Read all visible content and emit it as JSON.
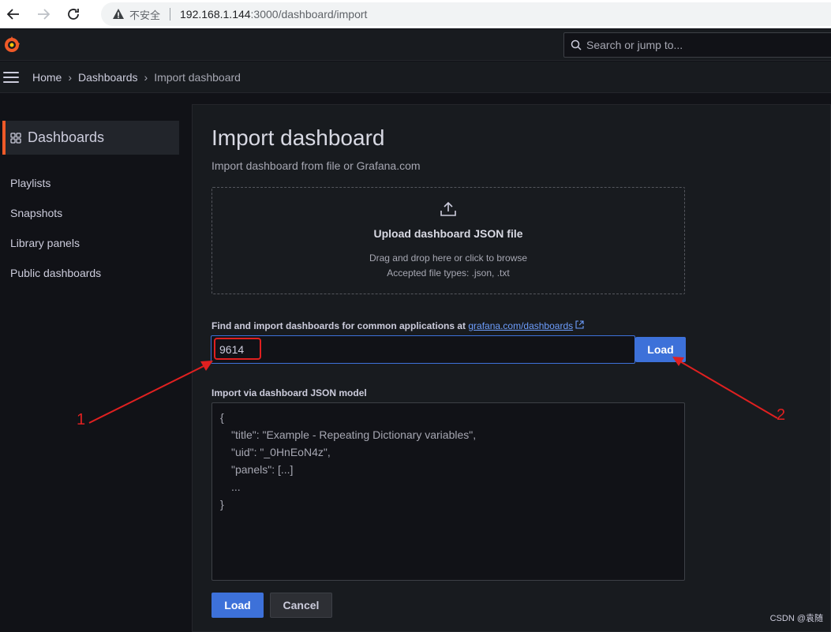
{
  "browser": {
    "security_label": "不安全",
    "url_host": "192.168.1.144",
    "url_path": ":3000/dashboard/import"
  },
  "topbar": {
    "search_placeholder": "Search or jump to..."
  },
  "breadcrumb": {
    "items": [
      "Home",
      "Dashboards",
      "Import dashboard"
    ]
  },
  "sidebar": {
    "title": "Dashboards",
    "items": [
      "Playlists",
      "Snapshots",
      "Library panels",
      "Public dashboards"
    ]
  },
  "main": {
    "title": "Import dashboard",
    "subtitle": "Import dashboard from file or Grafana.com",
    "upload": {
      "title": "Upload dashboard JSON file",
      "hint_line1": "Drag and drop here or click to browse",
      "hint_line2": "Accepted file types: .json, .txt"
    },
    "find": {
      "label": "Find and import dashboards for common applications at",
      "link": "grafana.com/dashboards",
      "input_value": "9614",
      "load_label": "Load"
    },
    "json_model": {
      "label": "Import via dashboard JSON model",
      "lines": [
        "{",
        "\"title\": \"Example - Repeating Dictionary variables\",",
        "\"uid\": \"_0HnEoN4z\",",
        "\"panels\": [...]",
        "...",
        "}"
      ]
    },
    "buttons": {
      "load": "Load",
      "cancel": "Cancel"
    }
  },
  "annotations": {
    "marker1": "1",
    "marker2": "2",
    "color": "#e02020"
  },
  "watermark": "CSDN @袁随"
}
